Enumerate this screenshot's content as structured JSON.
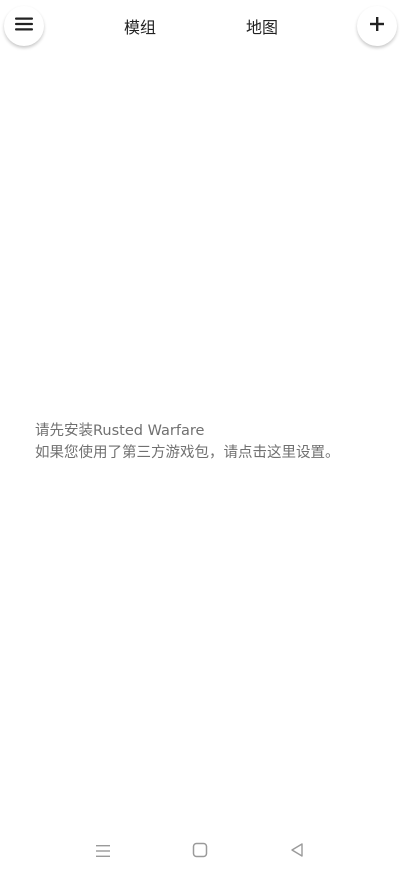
{
  "header": {
    "menu_icon": "hamburger-menu-icon",
    "add_icon": "plus-icon",
    "tabs": [
      {
        "label": "模组"
      },
      {
        "label": "地图"
      }
    ]
  },
  "main": {
    "line1": "请先安装Rusted Warfare",
    "line2": "如果您使用了第三方游戏包，请点击这里设置。"
  },
  "nav": {
    "icons": [
      "recents-icon",
      "home-icon",
      "back-icon"
    ]
  },
  "colors": {
    "background": "#ffffff",
    "text_primary": "#222222",
    "text_secondary": "#707070"
  }
}
